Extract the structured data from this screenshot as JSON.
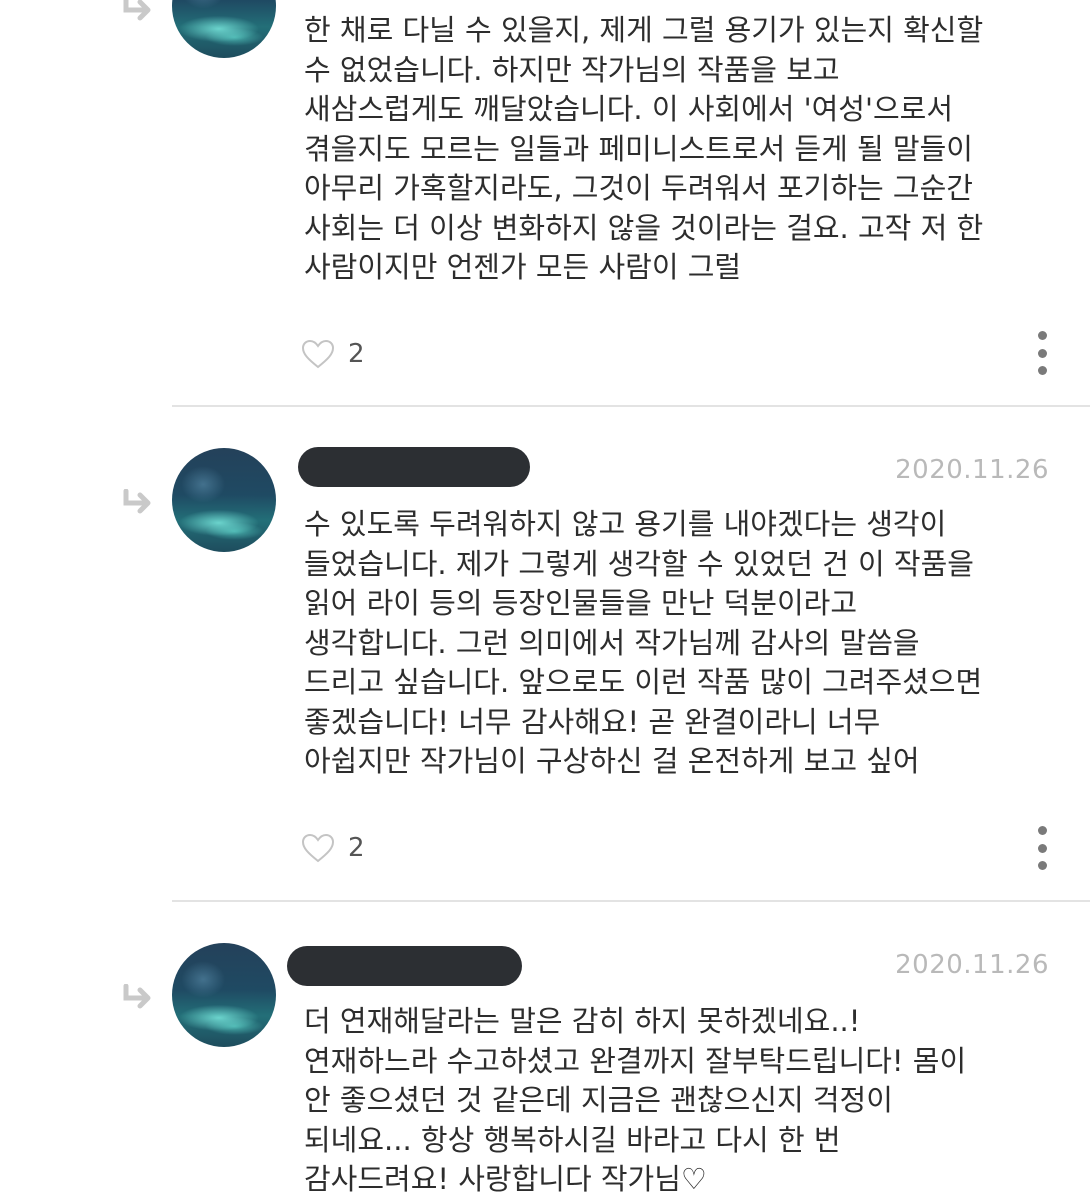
{
  "comments": [
    {
      "date": "",
      "lines": [
        "한 채로 다닐 수 있을지, 제게 그럴 용기가 있는지 확신할",
        "수 없었습니다. 하지만 작가님의 작품을 보고",
        "새삼스럽게도 깨달았습니다. 이 사회에서 '여성'으로서",
        "겪을지도 모르는 일들과 페미니스트로서 듣게 될 말들이",
        "아무리 가혹할지라도, 그것이 두려워서 포기하는 그순간",
        "사회는 더 이상 변화하지 않을 것이라는 걸요. 고작 저 한",
        "사람이지만 언젠가 모든 사람이 그럴"
      ],
      "like_count": "2"
    },
    {
      "date": "2020.11.26",
      "lines": [
        "수 있도록 두려워하지 않고 용기를 내야겠다는 생각이",
        "들었습니다. 제가 그렇게 생각할 수 있었던 건 이 작품을",
        "읽어 라이 등의 등장인물들을 만난 덕분이라고",
        "생각합니다. 그런 의미에서 작가님께 감사의 말씀을",
        "드리고 싶습니다. 앞으로도 이런 작품 많이 그려주셨으면",
        "좋겠습니다! 너무 감사해요! 곧 완결이라니 너무",
        "아쉽지만 작가님이 구상하신 걸 온전하게 보고 싶어"
      ],
      "like_count": "2"
    },
    {
      "date": "2020.11.26",
      "lines": [
        "더 연재해달라는 말은 감히 하지 못하겠네요..!",
        "연재하느라 수고하셨고 완결까지 잘부탁드립니다! 몸이",
        "안 좋으셨던 것 같은데 지금은 괜찮으신지 걱정이",
        "되네요... 항상 행복하시길 바라고 다시 한 번",
        "감사드려요! 사랑합니다 작가님♡"
      ],
      "like_count": ""
    }
  ],
  "icons": {
    "reply": "reply-arrow-icon",
    "like": "heart-outline-icon",
    "more": "more-vertical-icon",
    "avatar": "aurora-avatar-image"
  },
  "colors": {
    "body_text": "#2d2d2d",
    "date_text": "#b9b9b9",
    "redaction": "#2c2f33",
    "divider": "#e3e3e3"
  }
}
